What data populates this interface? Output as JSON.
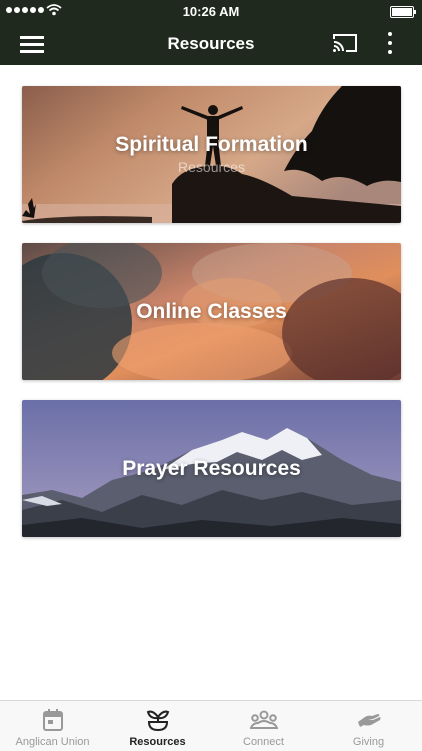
{
  "status_bar": {
    "time": "10:26 AM"
  },
  "app_bar": {
    "title": "Resources"
  },
  "cards": [
    {
      "title": "Spiritual Formation",
      "subtitle": "Resources"
    },
    {
      "title": "Online Classes"
    },
    {
      "title": "Prayer Resources"
    }
  ],
  "tab_bar": {
    "items": [
      {
        "label": "Anglican Union",
        "icon": "calendar-icon"
      },
      {
        "label": "Resources",
        "icon": "sprout-icon",
        "active": true
      },
      {
        "label": "Connect",
        "icon": "people-icon"
      },
      {
        "label": "Giving",
        "icon": "hand-icon"
      }
    ]
  },
  "colors": {
    "app_bar": "#1f291d",
    "tab_active": "#222222",
    "tab_inactive": "#999999"
  }
}
